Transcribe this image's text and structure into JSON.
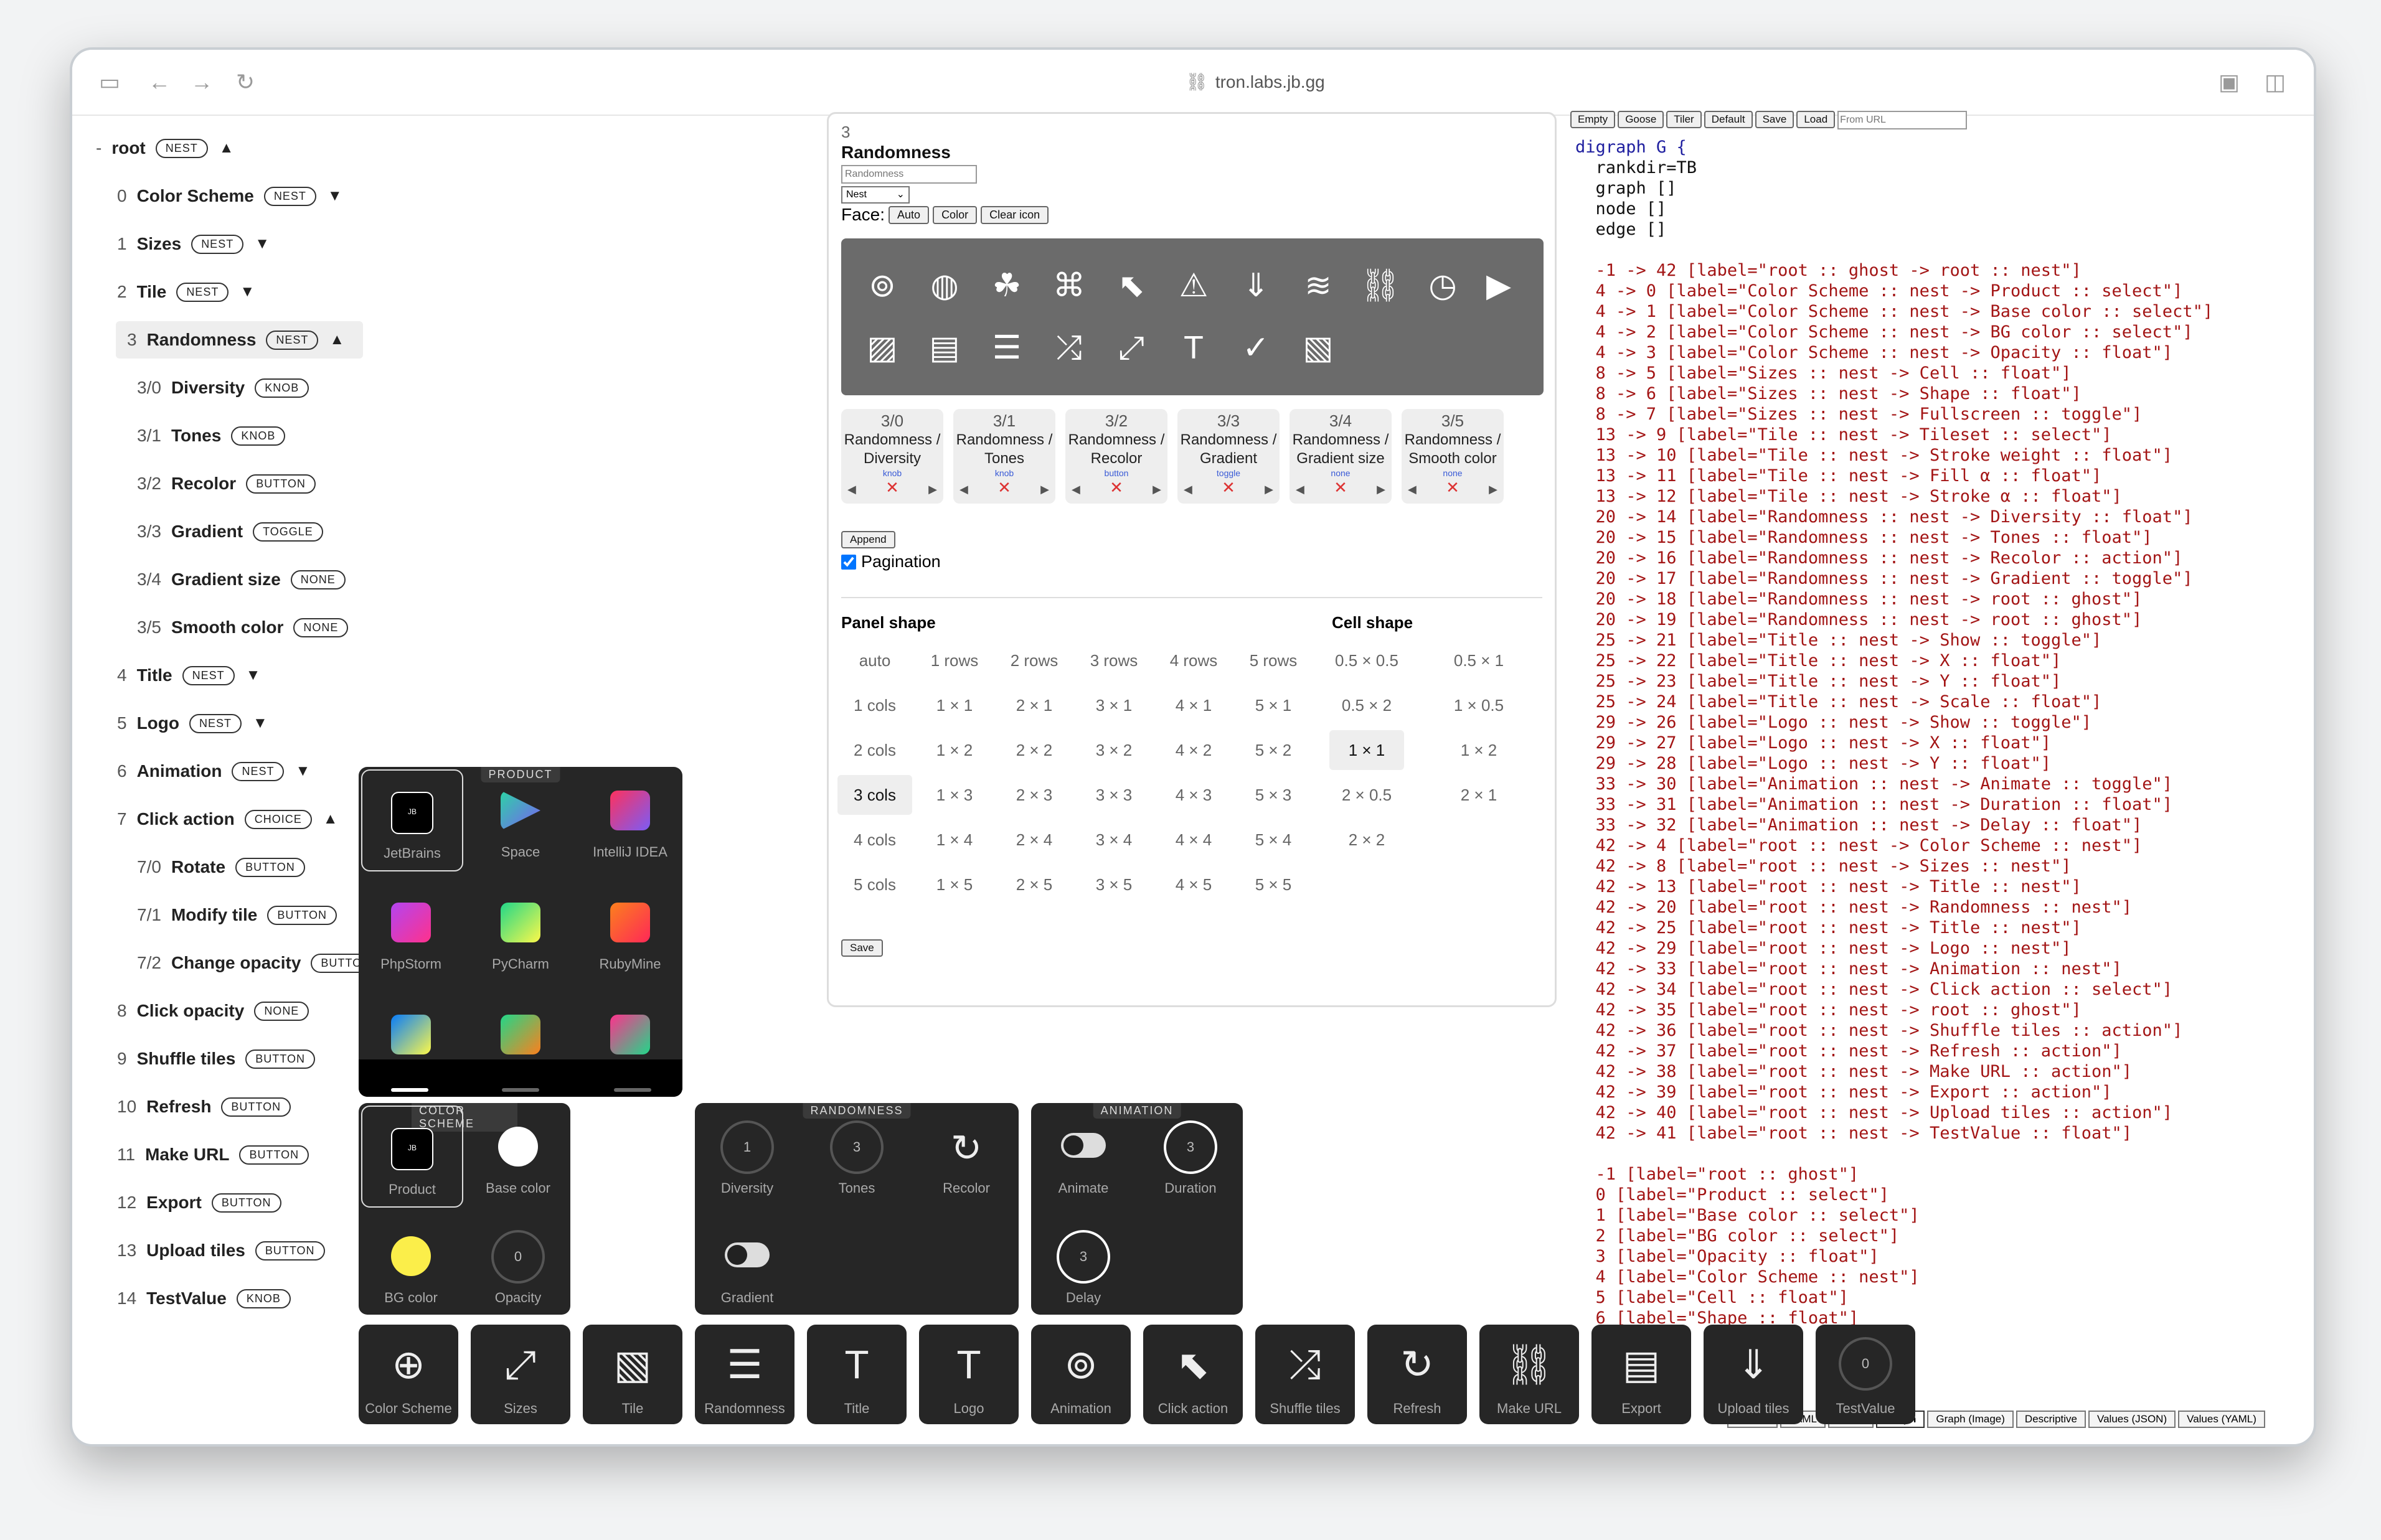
{
  "url": "tron.labs.jb.gg",
  "tree": [
    {
      "idx": "-",
      "name": "root",
      "badge": "NEST",
      "arrow": "▲",
      "indent": 0
    },
    {
      "idx": "0",
      "name": "Color Scheme",
      "badge": "NEST",
      "arrow": "▼",
      "indent": 1
    },
    {
      "idx": "1",
      "name": "Sizes",
      "badge": "NEST",
      "arrow": "▼",
      "indent": 1
    },
    {
      "idx": "2",
      "name": "Tile",
      "badge": "NEST",
      "arrow": "▼",
      "indent": 1
    },
    {
      "idx": "3",
      "name": "Randomness",
      "badge": "NEST",
      "arrow": "▲",
      "indent": 1,
      "selected": true
    },
    {
      "idx": "3/0",
      "name": "Diversity",
      "badge": "KNOB",
      "arrow": "",
      "indent": 2
    },
    {
      "idx": "3/1",
      "name": "Tones",
      "badge": "KNOB",
      "arrow": "",
      "indent": 2
    },
    {
      "idx": "3/2",
      "name": "Recolor",
      "badge": "BUTTON",
      "arrow": "",
      "indent": 2
    },
    {
      "idx": "3/3",
      "name": "Gradient",
      "badge": "TOGGLE",
      "arrow": "",
      "indent": 2
    },
    {
      "idx": "3/4",
      "name": "Gradient size",
      "badge": "NONE",
      "arrow": "",
      "indent": 2
    },
    {
      "idx": "3/5",
      "name": "Smooth color",
      "badge": "NONE",
      "arrow": "",
      "indent": 2
    },
    {
      "idx": "4",
      "name": "Title",
      "badge": "NEST",
      "arrow": "▼",
      "indent": 1
    },
    {
      "idx": "5",
      "name": "Logo",
      "badge": "NEST",
      "arrow": "▼",
      "indent": 1
    },
    {
      "idx": "6",
      "name": "Animation",
      "badge": "NEST",
      "arrow": "▼",
      "indent": 1
    },
    {
      "idx": "7",
      "name": "Click action",
      "badge": "CHOICE",
      "arrow": "▲",
      "indent": 1
    },
    {
      "idx": "7/0",
      "name": "Rotate",
      "badge": "BUTTON",
      "arrow": "",
      "indent": 2
    },
    {
      "idx": "7/1",
      "name": "Modify tile",
      "badge": "BUTTON",
      "arrow": "",
      "indent": 2
    },
    {
      "idx": "7/2",
      "name": "Change opacity",
      "badge": "BUTTON",
      "arrow": "",
      "indent": 2
    },
    {
      "idx": "8",
      "name": "Click opacity",
      "badge": "NONE",
      "arrow": "",
      "indent": 1
    },
    {
      "idx": "9",
      "name": "Shuffle tiles",
      "badge": "BUTTON",
      "arrow": "",
      "indent": 1
    },
    {
      "idx": "10",
      "name": "Refresh",
      "badge": "BUTTON",
      "arrow": "",
      "indent": 1
    },
    {
      "idx": "11",
      "name": "Make URL",
      "badge": "BUTTON",
      "arrow": "",
      "indent": 1
    },
    {
      "idx": "12",
      "name": "Export",
      "badge": "BUTTON",
      "arrow": "",
      "indent": 1
    },
    {
      "idx": "13",
      "name": "Upload tiles",
      "badge": "BUTTON",
      "arrow": "",
      "indent": 1
    },
    {
      "idx": "14",
      "name": "TestValue",
      "badge": "KNOB",
      "arrow": "",
      "indent": 1
    }
  ],
  "editor": {
    "index": "3",
    "title": "Randomness",
    "name_placeholder": "Randomness",
    "type_value": "Nest",
    "face_label": "Face:",
    "face_buttons": [
      "Auto",
      "Color",
      "Clear icon"
    ],
    "cards": [
      {
        "num": "3/0",
        "title": "Randomness / Diversity",
        "kind": "knob"
      },
      {
        "num": "3/1",
        "title": "Randomness / Tones",
        "kind": "knob"
      },
      {
        "num": "3/2",
        "title": "Randomness / Recolor",
        "kind": "button"
      },
      {
        "num": "3/3",
        "title": "Randomness / Gradient",
        "kind": "toggle"
      },
      {
        "num": "3/4",
        "title": "Randomness / Gradient size",
        "kind": "none"
      },
      {
        "num": "3/5",
        "title": "Randomness / Smooth color",
        "kind": "none"
      }
    ],
    "append_label": "Append",
    "pagination_label": "Pagination",
    "panel_shape_label": "Panel shape",
    "cell_shape_label": "Cell shape",
    "panel_cols_header": [
      "auto",
      "1 rows",
      "2 rows",
      "3 rows",
      "4 rows",
      "5 rows"
    ],
    "panel_rows": [
      [
        "1 cols",
        "1 × 1",
        "2 × 1",
        "3 × 1",
        "4 × 1",
        "5 × 1"
      ],
      [
        "2 cols",
        "1 × 2",
        "2 × 2",
        "3 × 2",
        "4 × 2",
        "5 × 2"
      ],
      [
        "3 cols",
        "1 × 3",
        "2 × 3",
        "3 × 3",
        "4 × 3",
        "5 × 3"
      ],
      [
        "4 cols",
        "1 × 4",
        "2 × 4",
        "3 × 4",
        "4 × 4",
        "5 × 4"
      ],
      [
        "5 cols",
        "1 × 5",
        "2 × 5",
        "3 × 5",
        "4 × 5",
        "5 × 5"
      ]
    ],
    "cell_shapes": [
      [
        "0.5 × 0.5",
        "0.5 × 1"
      ],
      [
        "0.5 × 2",
        "1 × 0.5"
      ],
      [
        "1 × 1",
        "1 × 2"
      ],
      [
        "2 × 0.5",
        "2 × 1"
      ],
      [
        "2 × 2",
        ""
      ]
    ],
    "save_label": "Save"
  },
  "right_toolbar": [
    "Empty",
    "Goose",
    "Tiler",
    "Default",
    "Save",
    "Load"
  ],
  "from_url_placeholder": "From URL",
  "code_lines": [
    "digraph G {",
    "  rankdir=TB",
    "  graph []",
    "  node []",
    "  edge []",
    "",
    "  -1 -> 42 [label=\"root :: ghost -> root :: nest\"]",
    "  4 -> 0 [label=\"Color Scheme :: nest -> Product :: select\"]",
    "  4 -> 1 [label=\"Color Scheme :: nest -> Base color :: select\"]",
    "  4 -> 2 [label=\"Color Scheme :: nest -> BG color :: select\"]",
    "  4 -> 3 [label=\"Color Scheme :: nest -> Opacity :: float\"]",
    "  8 -> 5 [label=\"Sizes :: nest -> Cell :: float\"]",
    "  8 -> 6 [label=\"Sizes :: nest -> Shape :: float\"]",
    "  8 -> 7 [label=\"Sizes :: nest -> Fullscreen :: toggle\"]",
    "  13 -> 9 [label=\"Tile :: nest -> Tileset :: select\"]",
    "  13 -> 10 [label=\"Tile :: nest -> Stroke weight :: float\"]",
    "  13 -> 11 [label=\"Tile :: nest -> Fill α :: float\"]",
    "  13 -> 12 [label=\"Tile :: nest -> Stroke α :: float\"]",
    "  20 -> 14 [label=\"Randomness :: nest -> Diversity :: float\"]",
    "  20 -> 15 [label=\"Randomness :: nest -> Tones :: float\"]",
    "  20 -> 16 [label=\"Randomness :: nest -> Recolor :: action\"]",
    "  20 -> 17 [label=\"Randomness :: nest -> Gradient :: toggle\"]",
    "  20 -> 18 [label=\"Randomness :: nest -> root :: ghost\"]",
    "  20 -> 19 [label=\"Randomness :: nest -> root :: ghost\"]",
    "  25 -> 21 [label=\"Title :: nest -> Show :: toggle\"]",
    "  25 -> 22 [label=\"Title :: nest -> X :: float\"]",
    "  25 -> 23 [label=\"Title :: nest -> Y :: float\"]",
    "  25 -> 24 [label=\"Title :: nest -> Scale :: float\"]",
    "  29 -> 26 [label=\"Logo :: nest -> Show :: toggle\"]",
    "  29 -> 27 [label=\"Logo :: nest -> X :: float\"]",
    "  29 -> 28 [label=\"Logo :: nest -> Y :: float\"]",
    "  33 -> 30 [label=\"Animation :: nest -> Animate :: toggle\"]",
    "  33 -> 31 [label=\"Animation :: nest -> Duration :: float\"]",
    "  33 -> 32 [label=\"Animation :: nest -> Delay :: float\"]",
    "  42 -> 4 [label=\"root :: nest -> Color Scheme :: nest\"]",
    "  42 -> 8 [label=\"root :: nest -> Sizes :: nest\"]",
    "  42 -> 13 [label=\"root :: nest -> Title :: nest\"]",
    "  42 -> 20 [label=\"root :: nest -> Randomness :: nest\"]",
    "  42 -> 25 [label=\"root :: nest -> Title :: nest\"]",
    "  42 -> 29 [label=\"root :: nest -> Logo :: nest\"]",
    "  42 -> 33 [label=\"root :: nest -> Animation :: nest\"]",
    "  42 -> 34 [label=\"root :: nest -> Click action :: select\"]",
    "  42 -> 35 [label=\"root :: nest -> root :: ghost\"]",
    "  42 -> 36 [label=\"root :: nest -> Shuffle tiles :: action\"]",
    "  42 -> 37 [label=\"root :: nest -> Refresh :: action\"]",
    "  42 -> 38 [label=\"root :: nest -> Make URL :: action\"]",
    "  42 -> 39 [label=\"root :: nest -> Export :: action\"]",
    "  42 -> 40 [label=\"root :: nest -> Upload tiles :: action\"]",
    "  42 -> 41 [label=\"root :: nest -> TestValue :: float\"]",
    "",
    "  -1 [label=\"root :: ghost\"]",
    "  0 [label=\"Product :: select\"]",
    "  1 [label=\"Base color :: select\"]",
    "  2 [label=\"BG color :: select\"]",
    "  3 [label=\"Opacity :: float\"]",
    "  4 [label=\"Color Scheme :: nest\"]",
    "  5 [label=\"Cell :: float\"]",
    "  6 [label=\"Shape :: float\"]"
  ],
  "bottom_tabs": [
    "Builder",
    "YAML",
    "JSON",
    "Graph",
    "Graph (Image)",
    "Descriptive",
    "Values (JSON)",
    "Values (YAML)"
  ],
  "active_tab": "Graph",
  "product_panel": {
    "header": "PRODUCT",
    "items": [
      "JetBrains",
      "Space",
      "IntelliJ IDEA",
      "PhpStorm",
      "PyCharm",
      "RubyMine"
    ]
  },
  "color_panel": {
    "header": "COLOR SCHEME",
    "items": [
      "Product",
      "Base color",
      "BG color",
      "Opacity"
    ],
    "opacity_value": "0"
  },
  "randomness_panel": {
    "header": "RANDOMNESS",
    "items": [
      "Diversity",
      "Tones",
      "Recolor",
      "Gradient"
    ],
    "diversity_value": "1",
    "tones_value": "3"
  },
  "animation_panel": {
    "header": "ANIMATION",
    "items": [
      "Animate",
      "Duration",
      "Delay"
    ],
    "duration_value": "3",
    "delay_value": "3"
  },
  "dock": [
    "Color Scheme",
    "Sizes",
    "Tile",
    "Randomness",
    "Title",
    "Logo",
    "Animation",
    "Click action",
    "Shuffle tiles",
    "Refresh",
    "Make URL",
    "Export",
    "Upload tiles",
    "TestValue"
  ],
  "testvalue_value": "0",
  "colors": {
    "accent": "#3a5bd6",
    "dark": "#262626",
    "panel_bg": "#6b6b6b"
  }
}
